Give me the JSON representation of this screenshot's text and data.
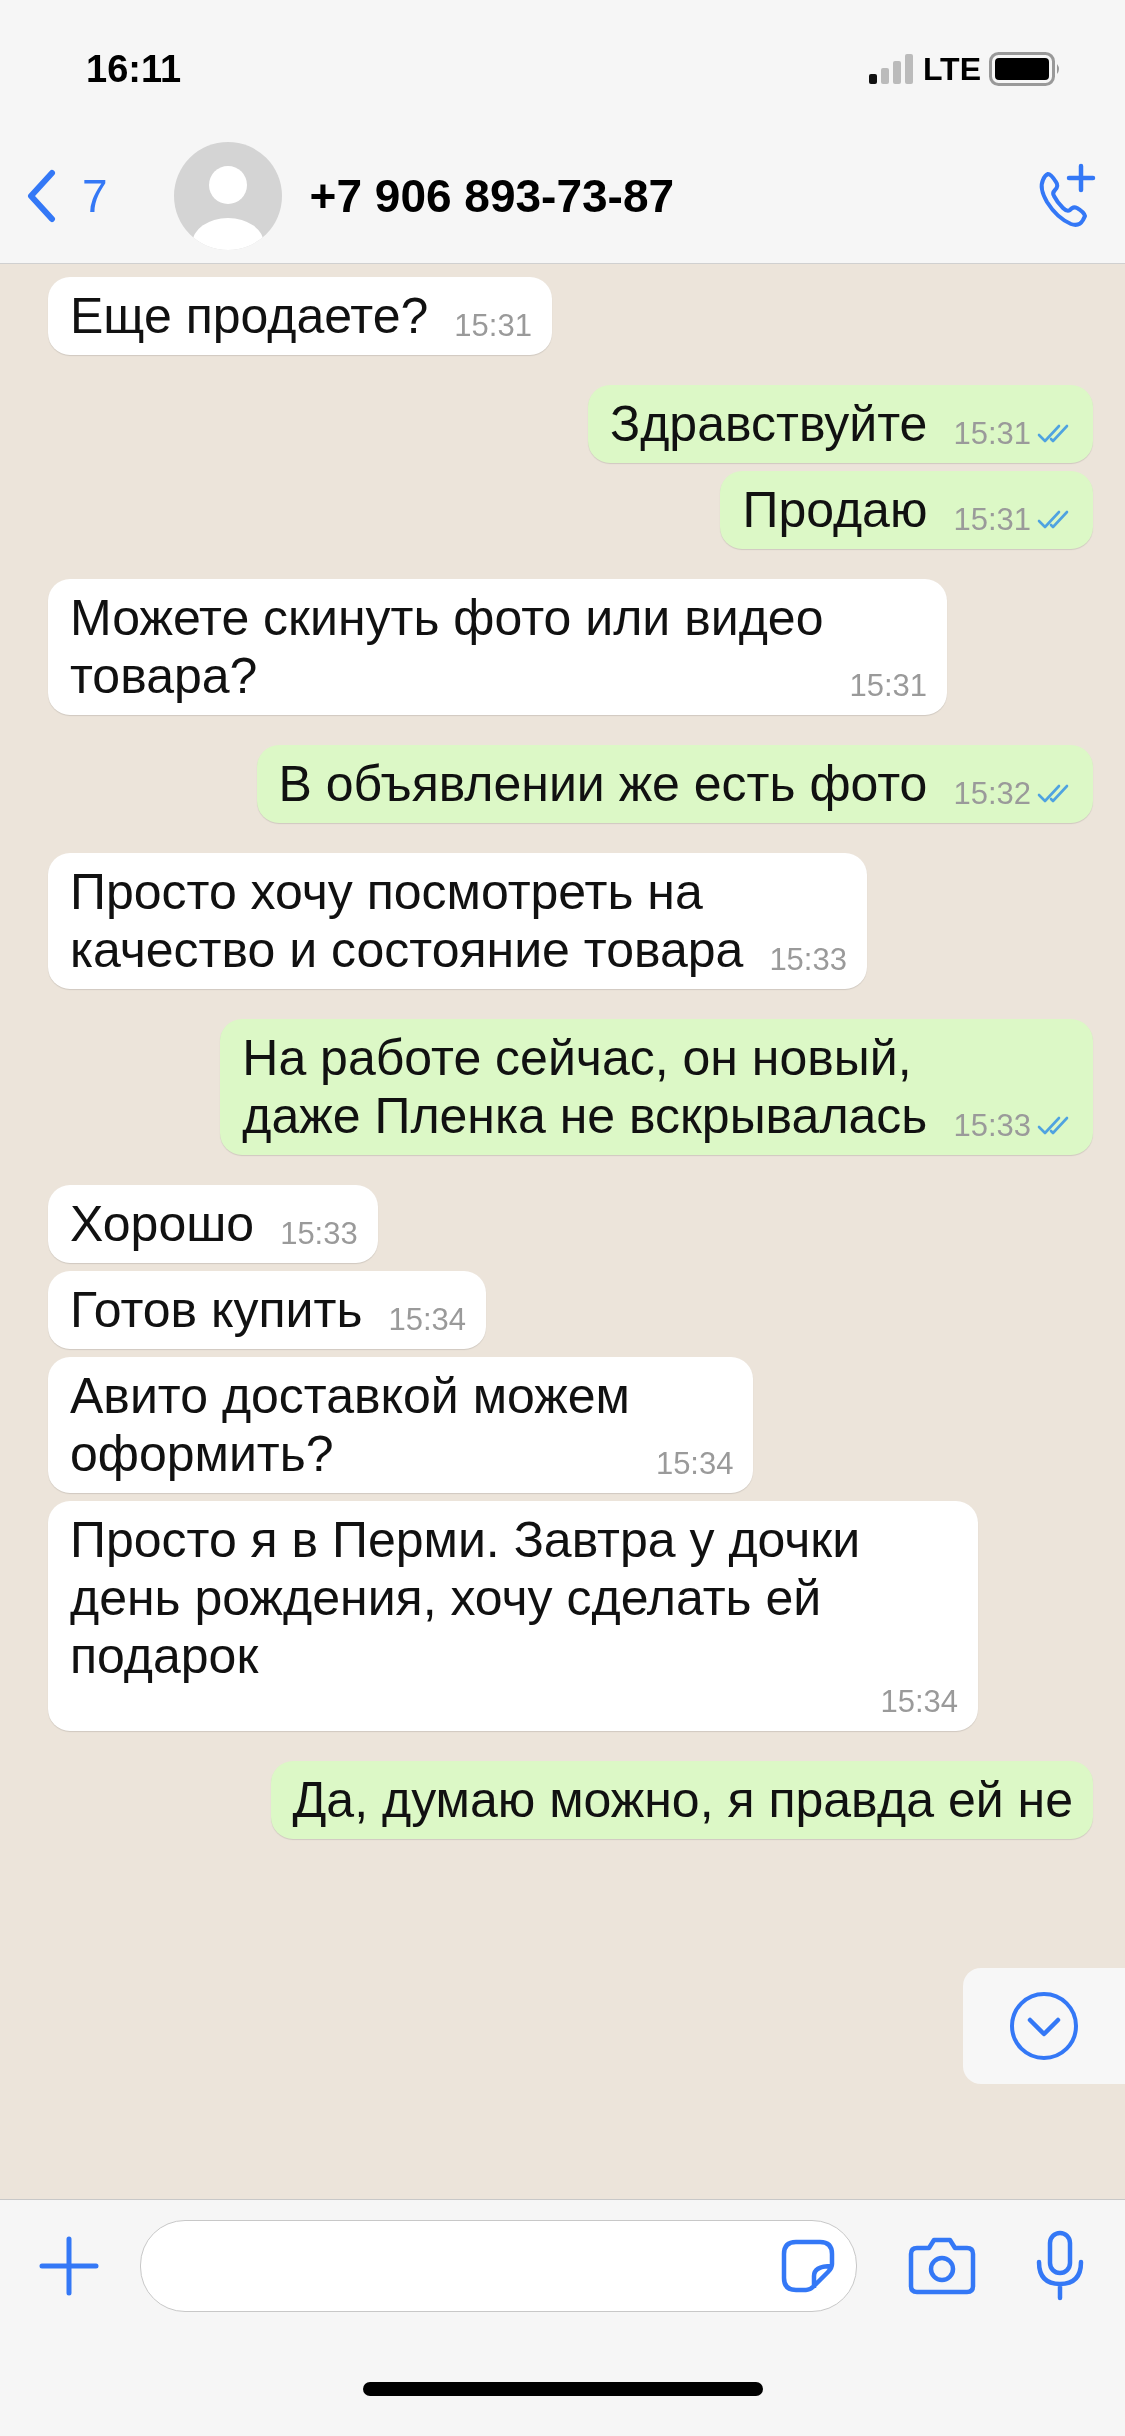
{
  "status_bar": {
    "time": "16:11",
    "network": "LTE"
  },
  "header": {
    "back_count": "7",
    "title": "+7 906 893-73-87"
  },
  "messages": [
    {
      "kind": "incoming",
      "text": "Еще продаете?",
      "time": "15:31"
    },
    {
      "kind": "outgoing",
      "text": "Здравствуйте",
      "time": "15:31",
      "read": true
    },
    {
      "kind": "outgoing",
      "text": "Продаю",
      "time": "15:31",
      "read": true
    },
    {
      "kind": "incoming",
      "text": "Можете скинуть фото или видео\nтовара?",
      "time": "15:31"
    },
    {
      "kind": "outgoing",
      "text": "В объявлении же есть фото",
      "time": "15:32",
      "read": true
    },
    {
      "kind": "incoming",
      "text": "Просто хочу посмотреть на\nкачество и состояние товара",
      "time": "15:33"
    },
    {
      "kind": "outgoing",
      "text": "На работе сейчас, он новый,\nдаже Пленка не вскрывалась",
      "time": "15:33",
      "read": true
    },
    {
      "kind": "incoming",
      "text": "Хорошо",
      "time": "15:33"
    },
    {
      "kind": "incoming",
      "text": "Готов купить",
      "time": "15:34"
    },
    {
      "kind": "incoming",
      "text": "Авито доставкой можем\nоформить?",
      "time": "15:34"
    },
    {
      "kind": "incoming",
      "text": "Просто я в Перми. Завтра у дочки\nдень рождения, хочу сделать ей\nподарок",
      "time": "15:34"
    },
    {
      "kind": "outgoing",
      "text": "Да, думаю можно, я правда ей не"
    }
  ]
}
